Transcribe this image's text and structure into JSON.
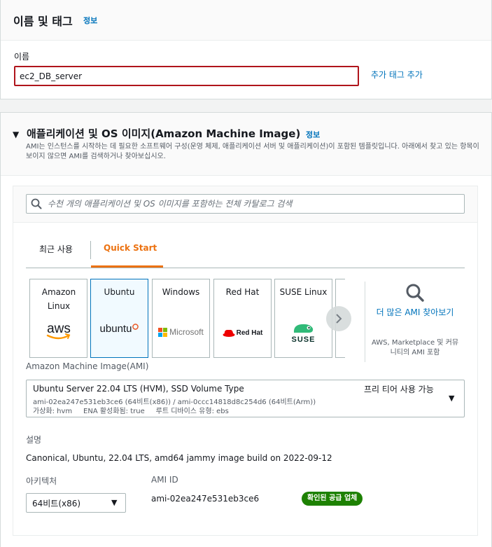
{
  "name_tags": {
    "title": "이름 및 태그",
    "info": "정보",
    "name_label": "이름",
    "name_value": "ec2_DB_server",
    "add_tag": "추가 태그 추가"
  },
  "ami": {
    "title": "애플리케이션 및 OS 이미지(Amazon Machine Image)",
    "info": "정보",
    "description": "AMI는 인스턴스를 시작하는 데 필요한 소프트웨어 구성(운영 체제, 애플리케이션 서버 및 애플리케이션)이 포함된 템플릿입니다. 아래에서 찾고 있는 항목이 보이지 않으면 AMI를 검색하거나 찾아보십시오.",
    "search_placeholder": "수천 개의 애플리케이션 및 OS 이미지를 포함하는 전체 카탈로그 검색",
    "tabs": [
      {
        "label": "최근 사용",
        "active": false
      },
      {
        "label": "Quick Start",
        "active": true
      }
    ],
    "os_cards": [
      {
        "name": "Amazon Linux",
        "logo": "aws",
        "logo_text": "aws",
        "selected": false
      },
      {
        "name": "Ubuntu",
        "logo": "ubuntu",
        "logo_text": "ubuntu",
        "selected": true
      },
      {
        "name": "Windows",
        "logo": "microsoft",
        "logo_text": "Microsoft",
        "selected": false
      },
      {
        "name": "Red Hat",
        "logo": "redhat",
        "logo_text": "Red Hat",
        "selected": false
      },
      {
        "name": "SUSE Linux",
        "logo": "suse",
        "logo_text": "SUSE",
        "selected": false
      }
    ],
    "more_link": "더 많은 AMI 찾아보기",
    "more_sub": "AWS, Marketplace 및 커뮤니티의 AMI 포함",
    "select_label": "Amazon Machine Image(AMI)",
    "selected_ami": {
      "name": "Ubuntu Server 22.04 LTS (HVM), SSD Volume Type",
      "ids": "ami-02ea247e531eb3ce6 (64비트(x86)) / ami-0ccc14818d8c254d6 (64비트(Arm))",
      "attrs": "가상화: hvm     ENA 활성화됨: true     루트 디바이스 유형: ebs",
      "free_tier": "프리 티어 사용 가능"
    },
    "desc_label": "설명",
    "desc_value": "Canonical, Ubuntu, 22.04 LTS, amd64 jammy image build on 2022-09-12",
    "arch_label": "아키텍처",
    "arch_value": "64비트(x86)",
    "amiid_label": "AMI ID",
    "amiid_value": "ami-02ea247e531eb3ce6",
    "verified_badge": "확인된 공급 업체"
  },
  "colors": {
    "link": "#0073bb",
    "accent": "#ec7211",
    "error_border": "#b0141b",
    "verified": "#1d8102"
  }
}
